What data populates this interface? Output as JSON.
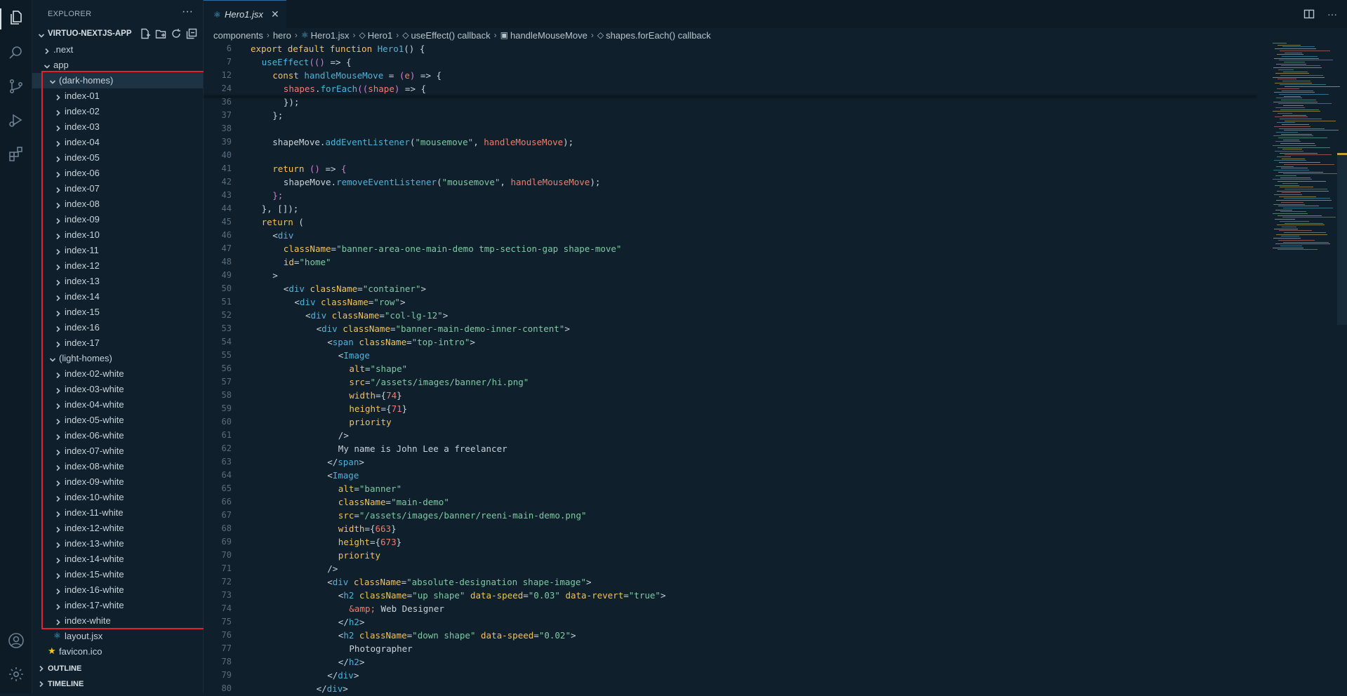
{
  "explorer": {
    "header": "EXPLORER",
    "more": "···",
    "project": "VIRTUO-NEXTJS-APP",
    "items": [
      {
        "label": ".next",
        "depth": 1,
        "kind": "folder",
        "open": false
      },
      {
        "label": "app",
        "depth": 1,
        "kind": "folder",
        "open": true
      },
      {
        "label": "(dark-homes)",
        "depth": 2,
        "kind": "folder",
        "open": true,
        "selected": true
      },
      {
        "label": "index-01",
        "depth": 3,
        "kind": "folder",
        "open": false
      },
      {
        "label": "index-02",
        "depth": 3,
        "kind": "folder",
        "open": false
      },
      {
        "label": "index-03",
        "depth": 3,
        "kind": "folder",
        "open": false
      },
      {
        "label": "index-04",
        "depth": 3,
        "kind": "folder",
        "open": false
      },
      {
        "label": "index-05",
        "depth": 3,
        "kind": "folder",
        "open": false
      },
      {
        "label": "index-06",
        "depth": 3,
        "kind": "folder",
        "open": false
      },
      {
        "label": "index-07",
        "depth": 3,
        "kind": "folder",
        "open": false
      },
      {
        "label": "index-08",
        "depth": 3,
        "kind": "folder",
        "open": false
      },
      {
        "label": "index-09",
        "depth": 3,
        "kind": "folder",
        "open": false
      },
      {
        "label": "index-10",
        "depth": 3,
        "kind": "folder",
        "open": false
      },
      {
        "label": "index-11",
        "depth": 3,
        "kind": "folder",
        "open": false
      },
      {
        "label": "index-12",
        "depth": 3,
        "kind": "folder",
        "open": false
      },
      {
        "label": "index-13",
        "depth": 3,
        "kind": "folder",
        "open": false
      },
      {
        "label": "index-14",
        "depth": 3,
        "kind": "folder",
        "open": false
      },
      {
        "label": "index-15",
        "depth": 3,
        "kind": "folder",
        "open": false
      },
      {
        "label": "index-16",
        "depth": 3,
        "kind": "folder",
        "open": false
      },
      {
        "label": "index-17",
        "depth": 3,
        "kind": "folder",
        "open": false
      },
      {
        "label": "(light-homes)",
        "depth": 2,
        "kind": "folder",
        "open": true
      },
      {
        "label": "index-02-white",
        "depth": 3,
        "kind": "folder",
        "open": false
      },
      {
        "label": "index-03-white",
        "depth": 3,
        "kind": "folder",
        "open": false
      },
      {
        "label": "index-04-white",
        "depth": 3,
        "kind": "folder",
        "open": false
      },
      {
        "label": "index-05-white",
        "depth": 3,
        "kind": "folder",
        "open": false
      },
      {
        "label": "index-06-white",
        "depth": 3,
        "kind": "folder",
        "open": false
      },
      {
        "label": "index-07-white",
        "depth": 3,
        "kind": "folder",
        "open": false
      },
      {
        "label": "index-08-white",
        "depth": 3,
        "kind": "folder",
        "open": false
      },
      {
        "label": "index-09-white",
        "depth": 3,
        "kind": "folder",
        "open": false
      },
      {
        "label": "index-10-white",
        "depth": 3,
        "kind": "folder",
        "open": false
      },
      {
        "label": "index-11-white",
        "depth": 3,
        "kind": "folder",
        "open": false
      },
      {
        "label": "index-12-white",
        "depth": 3,
        "kind": "folder",
        "open": false
      },
      {
        "label": "index-13-white",
        "depth": 3,
        "kind": "folder",
        "open": false
      },
      {
        "label": "index-14-white",
        "depth": 3,
        "kind": "folder",
        "open": false
      },
      {
        "label": "index-15-white",
        "depth": 3,
        "kind": "folder",
        "open": false
      },
      {
        "label": "index-16-white",
        "depth": 3,
        "kind": "folder",
        "open": false
      },
      {
        "label": "index-17-white",
        "depth": 3,
        "kind": "folder",
        "open": false
      },
      {
        "label": "index-white",
        "depth": 3,
        "kind": "folder",
        "open": false
      },
      {
        "label": "layout.jsx",
        "depth": 3,
        "kind": "react-file"
      },
      {
        "label": "favicon.ico",
        "depth": 2,
        "kind": "star-file"
      }
    ],
    "sections": [
      "OUTLINE",
      "TIMELINE"
    ]
  },
  "editor": {
    "tab": {
      "icon": "react-icon",
      "label": "Hero1.jsx",
      "close": "✕"
    },
    "breadcrumb": [
      "components",
      "hero",
      "Hero1.jsx",
      "Hero1",
      "useEffect() callback",
      "handleMouseMove",
      "shapes.forEach() callback"
    ],
    "lines": [
      {
        "n": "6",
        "ind": 3,
        "t": [
          [
            "k",
            "export "
          ],
          [
            "k",
            "default "
          ],
          [
            "k",
            "function "
          ],
          [
            "f",
            "Hero1"
          ],
          [
            "w",
            "() {"
          ]
        ]
      },
      {
        "n": "7",
        "ind": 4,
        "t": [
          [
            "f",
            "useEffect"
          ],
          [
            "p",
            "(("
          ],
          [
            "p",
            ")"
          ],
          [
            "w",
            " => {"
          ]
        ]
      },
      {
        "n": "12",
        "ind": 5,
        "t": [
          [
            "k",
            "const "
          ],
          [
            "f",
            "handleMouseMove"
          ],
          [
            "w",
            " = "
          ],
          [
            "p",
            "("
          ],
          [
            "n",
            "e"
          ],
          [
            "p",
            ")"
          ],
          [
            "w",
            " => {"
          ]
        ]
      },
      {
        "n": "24",
        "ind": 6,
        "t": [
          [
            "n",
            "shapes"
          ],
          [
            "w",
            "."
          ],
          [
            "f",
            "forEach"
          ],
          [
            "p",
            "(("
          ],
          [
            "n",
            "shape"
          ],
          [
            "p",
            ")"
          ],
          [
            "w",
            " => {"
          ]
        ]
      },
      {
        "n": "36",
        "ind": 6,
        "t": [
          [
            "w",
            "});"
          ]
        ]
      },
      {
        "n": "37",
        "ind": 5,
        "t": [
          [
            "w",
            "};"
          ]
        ]
      },
      {
        "n": "38",
        "ind": 0,
        "t": []
      },
      {
        "n": "39",
        "ind": 5,
        "t": [
          [
            "w",
            "shapeMove."
          ],
          [
            "f",
            "addEventListener"
          ],
          [
            "w",
            "("
          ],
          [
            "s",
            "\"mousemove\""
          ],
          [
            "w",
            ", "
          ],
          [
            "v",
            "handleMouseMove"
          ],
          [
            "w",
            ");"
          ]
        ]
      },
      {
        "n": "40",
        "ind": 0,
        "t": []
      },
      {
        "n": "41",
        "ind": 5,
        "t": [
          [
            "k",
            "return "
          ],
          [
            "p",
            "()"
          ],
          [
            "w",
            " => "
          ],
          [
            "p",
            "{"
          ]
        ]
      },
      {
        "n": "42",
        "ind": 6,
        "t": [
          [
            "w",
            "shapeMove."
          ],
          [
            "f",
            "removeEventListener"
          ],
          [
            "w",
            "("
          ],
          [
            "s",
            "\"mousemove\""
          ],
          [
            "w",
            ", "
          ],
          [
            "v",
            "handleMouseMove"
          ],
          [
            "w",
            ");"
          ]
        ]
      },
      {
        "n": "43",
        "ind": 5,
        "t": [
          [
            "p",
            "};"
          ]
        ]
      },
      {
        "n": "44",
        "ind": 4,
        "t": [
          [
            "w",
            "}, []);"
          ]
        ]
      },
      {
        "n": "45",
        "ind": 4,
        "t": [
          [
            "k",
            "return "
          ],
          [
            "w",
            "("
          ]
        ]
      },
      {
        "n": "46",
        "ind": 5,
        "t": [
          [
            "w",
            "<"
          ],
          [
            "t",
            "div"
          ]
        ]
      },
      {
        "n": "47",
        "ind": 6,
        "t": [
          [
            "a",
            "className"
          ],
          [
            "w",
            "="
          ],
          [
            "s",
            "\"banner-area-one-main-demo tmp-section-gap shape-move\""
          ]
        ]
      },
      {
        "n": "48",
        "ind": 6,
        "t": [
          [
            "a",
            "id"
          ],
          [
            "w",
            "="
          ],
          [
            "s",
            "\"home\""
          ]
        ]
      },
      {
        "n": "49",
        "ind": 5,
        "t": [
          [
            "w",
            ">"
          ]
        ]
      },
      {
        "n": "50",
        "ind": 6,
        "t": [
          [
            "w",
            "<"
          ],
          [
            "t",
            "div "
          ],
          [
            "a",
            "className"
          ],
          [
            "w",
            "="
          ],
          [
            "s",
            "\"container\""
          ],
          [
            "w",
            ">"
          ]
        ]
      },
      {
        "n": "51",
        "ind": 7,
        "t": [
          [
            "w",
            "<"
          ],
          [
            "t",
            "div "
          ],
          [
            "a",
            "className"
          ],
          [
            "w",
            "="
          ],
          [
            "s",
            "\"row\""
          ],
          [
            "w",
            ">"
          ]
        ]
      },
      {
        "n": "52",
        "ind": 8,
        "t": [
          [
            "w",
            "<"
          ],
          [
            "t",
            "div "
          ],
          [
            "a",
            "className"
          ],
          [
            "w",
            "="
          ],
          [
            "s",
            "\"col-lg-12\""
          ],
          [
            "w",
            ">"
          ]
        ]
      },
      {
        "n": "53",
        "ind": 9,
        "t": [
          [
            "w",
            "<"
          ],
          [
            "t",
            "div "
          ],
          [
            "a",
            "className"
          ],
          [
            "w",
            "="
          ],
          [
            "s",
            "\"banner-main-demo-inner-content\""
          ],
          [
            "w",
            ">"
          ]
        ]
      },
      {
        "n": "54",
        "ind": 10,
        "t": [
          [
            "w",
            "<"
          ],
          [
            "t",
            "span "
          ],
          [
            "a",
            "className"
          ],
          [
            "w",
            "="
          ],
          [
            "s",
            "\"top-intro\""
          ],
          [
            "w",
            ">"
          ]
        ]
      },
      {
        "n": "55",
        "ind": 11,
        "t": [
          [
            "w",
            "<"
          ],
          [
            "t",
            "Image"
          ]
        ]
      },
      {
        "n": "56",
        "ind": 12,
        "t": [
          [
            "a",
            "alt"
          ],
          [
            "w",
            "="
          ],
          [
            "s",
            "\"shape\""
          ]
        ]
      },
      {
        "n": "57",
        "ind": 12,
        "t": [
          [
            "a",
            "src"
          ],
          [
            "w",
            "="
          ],
          [
            "s",
            "\"/assets/images/banner/hi.png\""
          ]
        ]
      },
      {
        "n": "58",
        "ind": 12,
        "t": [
          [
            "a",
            "width"
          ],
          [
            "w",
            "={"
          ],
          [
            "n",
            "74"
          ],
          [
            "w",
            "}"
          ]
        ]
      },
      {
        "n": "59",
        "ind": 12,
        "t": [
          [
            "a",
            "height"
          ],
          [
            "w",
            "={"
          ],
          [
            "n",
            "71"
          ],
          [
            "w",
            "}"
          ]
        ]
      },
      {
        "n": "60",
        "ind": 12,
        "t": [
          [
            "a",
            "priority"
          ]
        ]
      },
      {
        "n": "61",
        "ind": 11,
        "t": [
          [
            "w",
            "/>"
          ]
        ]
      },
      {
        "n": "62",
        "ind": 11,
        "t": [
          [
            "w",
            "My name is John Lee a freelancer"
          ]
        ]
      },
      {
        "n": "63",
        "ind": 10,
        "t": [
          [
            "w",
            "</"
          ],
          [
            "t",
            "span"
          ],
          [
            "w",
            ">"
          ]
        ]
      },
      {
        "n": "64",
        "ind": 10,
        "t": [
          [
            "w",
            "<"
          ],
          [
            "t",
            "Image"
          ]
        ]
      },
      {
        "n": "65",
        "ind": 11,
        "t": [
          [
            "a",
            "alt"
          ],
          [
            "w",
            "="
          ],
          [
            "s",
            "\"banner\""
          ]
        ]
      },
      {
        "n": "66",
        "ind": 11,
        "t": [
          [
            "a",
            "className"
          ],
          [
            "w",
            "="
          ],
          [
            "s",
            "\"main-demo\""
          ]
        ]
      },
      {
        "n": "67",
        "ind": 11,
        "t": [
          [
            "a",
            "src"
          ],
          [
            "w",
            "="
          ],
          [
            "s",
            "\"/assets/images/banner/reeni-main-demo.png\""
          ]
        ]
      },
      {
        "n": "68",
        "ind": 11,
        "t": [
          [
            "a",
            "width"
          ],
          [
            "w",
            "={"
          ],
          [
            "n",
            "663"
          ],
          [
            "w",
            "}"
          ]
        ]
      },
      {
        "n": "69",
        "ind": 11,
        "t": [
          [
            "a",
            "height"
          ],
          [
            "w",
            "={"
          ],
          [
            "n",
            "673"
          ],
          [
            "w",
            "}"
          ]
        ]
      },
      {
        "n": "70",
        "ind": 11,
        "t": [
          [
            "a",
            "priority"
          ]
        ]
      },
      {
        "n": "71",
        "ind": 10,
        "t": [
          [
            "w",
            "/>"
          ]
        ]
      },
      {
        "n": "72",
        "ind": 10,
        "t": [
          [
            "w",
            "<"
          ],
          [
            "t",
            "div "
          ],
          [
            "a",
            "className"
          ],
          [
            "w",
            "="
          ],
          [
            "s",
            "\"absolute-designation shape-image\""
          ],
          [
            "w",
            ">"
          ]
        ]
      },
      {
        "n": "73",
        "ind": 11,
        "t": [
          [
            "w",
            "<"
          ],
          [
            "t",
            "h2 "
          ],
          [
            "a",
            "className"
          ],
          [
            "w",
            "="
          ],
          [
            "s",
            "\"up shape\" "
          ],
          [
            "a",
            "data-speed"
          ],
          [
            "w",
            "="
          ],
          [
            "s",
            "\"0.03\" "
          ],
          [
            "a",
            "data-revert"
          ],
          [
            "w",
            "="
          ],
          [
            "s",
            "\"true\""
          ],
          [
            "w",
            ">"
          ]
        ]
      },
      {
        "n": "74",
        "ind": 12,
        "t": [
          [
            "n",
            "&amp;"
          ],
          [
            "w",
            " Web Designer"
          ]
        ]
      },
      {
        "n": "75",
        "ind": 11,
        "t": [
          [
            "w",
            "</"
          ],
          [
            "t",
            "h2"
          ],
          [
            "w",
            ">"
          ]
        ]
      },
      {
        "n": "76",
        "ind": 11,
        "t": [
          [
            "w",
            "<"
          ],
          [
            "t",
            "h2 "
          ],
          [
            "a",
            "className"
          ],
          [
            "w",
            "="
          ],
          [
            "s",
            "\"down shape\" "
          ],
          [
            "a",
            "data-speed"
          ],
          [
            "w",
            "="
          ],
          [
            "s",
            "\"0.02\""
          ],
          [
            "w",
            ">"
          ]
        ]
      },
      {
        "n": "77",
        "ind": 12,
        "t": [
          [
            "w",
            "Photographer"
          ]
        ]
      },
      {
        "n": "78",
        "ind": 11,
        "t": [
          [
            "w",
            "</"
          ],
          [
            "t",
            "h2"
          ],
          [
            "w",
            ">"
          ]
        ]
      },
      {
        "n": "79",
        "ind": 10,
        "t": [
          [
            "w",
            "</"
          ],
          [
            "t",
            "div"
          ],
          [
            "w",
            ">"
          ]
        ]
      },
      {
        "n": "80",
        "ind": 9,
        "t": [
          [
            "w",
            "</"
          ],
          [
            "t",
            "div"
          ],
          [
            "w",
            ">"
          ]
        ]
      }
    ]
  },
  "colors": {
    "background": "#0f1f2b",
    "selection": "#1d3344",
    "highlight_box": "#e3222c",
    "keyword": "#f5c05a",
    "function": "#4fb3d9",
    "string": "#7ec9a3"
  }
}
